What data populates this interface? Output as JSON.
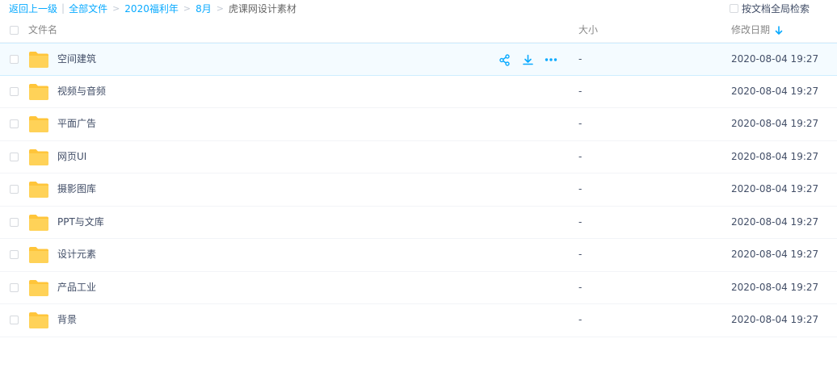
{
  "breadcrumb": {
    "back": "返回上一级",
    "all_files": "全部文件",
    "crumbs": [
      "2020福利年",
      "8月"
    ],
    "current": "虎课网设计素材",
    "sep": ">",
    "bar": "|"
  },
  "fulltext_search": {
    "label": "按文档全局检索"
  },
  "columns": {
    "name": "文件名",
    "size": "大小",
    "modified": "修改日期"
  },
  "colors": {
    "accent": "#09aaff",
    "folder": "#ffd258",
    "hover_row": "#f4fbff"
  },
  "rows": [
    {
      "name": "空间建筑",
      "size": "-",
      "modified": "2020-08-04 19:27"
    },
    {
      "name": "视频与音频",
      "size": "-",
      "modified": "2020-08-04 19:27"
    },
    {
      "name": "平面广告",
      "size": "-",
      "modified": "2020-08-04 19:27"
    },
    {
      "name": "网页UI",
      "size": "-",
      "modified": "2020-08-04 19:27"
    },
    {
      "name": "摄影图库",
      "size": "-",
      "modified": "2020-08-04 19:27"
    },
    {
      "name": "PPT与文库",
      "size": "-",
      "modified": "2020-08-04 19:27"
    },
    {
      "name": "设计元素",
      "size": "-",
      "modified": "2020-08-04 19:27"
    },
    {
      "name": "产品工业",
      "size": "-",
      "modified": "2020-08-04 19:27"
    },
    {
      "name": "背景",
      "size": "-",
      "modified": "2020-08-04 19:27"
    }
  ],
  "row_actions": [
    "share-icon",
    "download-icon",
    "more-icon"
  ]
}
